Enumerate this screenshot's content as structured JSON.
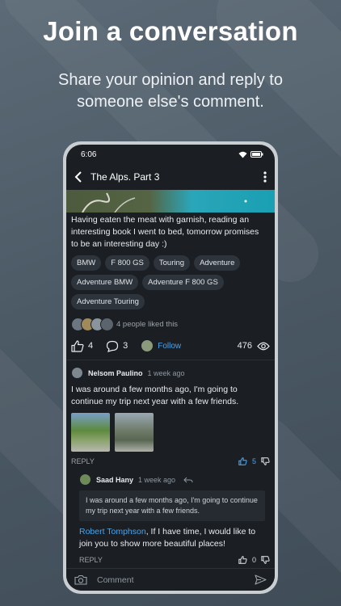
{
  "promo": {
    "headline": "Join a conversation",
    "subline": "Share your opinion and reply to someone else's comment."
  },
  "status_bar": {
    "time": "6:06"
  },
  "app_bar": {
    "title": "The Alps. Part 3",
    "back_icon": "back-arrow-icon",
    "menu_icon": "more-vertical-icon"
  },
  "post": {
    "text": "Having eaten the meat with garnish, reading an interesting book I went to bed, tomorrow promises to be an interesting day :)",
    "tags": [
      "BMW",
      "F 800 GS",
      "Touring",
      "Adventure",
      "Adventure BMW",
      "Adventure F 800 GS",
      "Adventure Touring"
    ],
    "liked_text": "4 people liked this",
    "likes_count": "4",
    "comments_count": "3",
    "follow_label": "Follow",
    "views_count": "476"
  },
  "comment": {
    "author": "Nelsom Paulino",
    "time": "1 week ago",
    "text": "I was around a few months ago, I'm going to continue my trip next year with a few friends.",
    "reply_label": "REPLY",
    "likes": "5"
  },
  "nested_reply": {
    "author": "Saad Hany",
    "time": "1 week ago",
    "quote": "I was around a few months ago, I'm going to continue my trip next year with a few friends.",
    "mention": "Robert Tomphson",
    "text": ", If I have time, I would like to join you to show more beautiful places!",
    "reply_label": "REPLY",
    "likes": "0"
  },
  "composer": {
    "placeholder": "Comment"
  },
  "colors": {
    "accent": "#4aa3e8",
    "background": "#1b1f24",
    "chip": "#2e343b"
  }
}
